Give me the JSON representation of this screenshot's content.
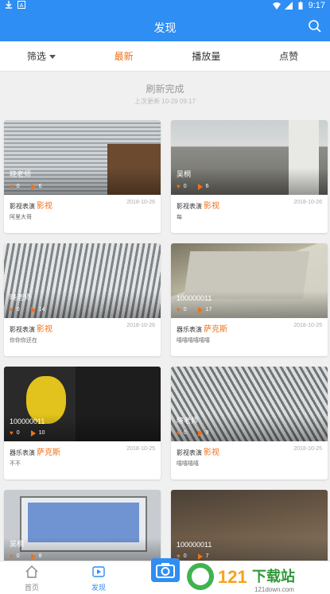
{
  "statusbar": {
    "time": "9:17"
  },
  "appbar": {
    "title": "发现"
  },
  "filters": [
    {
      "label": "筛选",
      "active": false
    },
    {
      "label": "最新",
      "active": true
    },
    {
      "label": "播放量",
      "active": false
    },
    {
      "label": "点赞",
      "active": false
    }
  ],
  "refresh": {
    "title": "刷新完成",
    "subtitle": "上次更新 10-29 09:17"
  },
  "cards": [
    {
      "author": "晓老师",
      "likes": "0",
      "plays": "6",
      "prefix": "影视表演",
      "category": "影视",
      "date": "2018-10-26",
      "desc": "阿里大哥"
    },
    {
      "author": "吴桐",
      "likes": "0",
      "plays": "6",
      "prefix": "影视表演",
      "category": "影视",
      "date": "2018-10-26",
      "desc": "每"
    },
    {
      "author": "晓老师",
      "likes": "0",
      "plays": "14",
      "prefix": "影视表演",
      "category": "影视",
      "date": "2018-10-26",
      "desc": "你你你还在"
    },
    {
      "author": "100000011",
      "likes": "0",
      "plays": "17",
      "prefix": "器乐表演",
      "category": "萨克斯",
      "date": "2018-10-25",
      "desc": "嘻嘻嘻嘻嘻嘻"
    },
    {
      "author": "100000011",
      "likes": "0",
      "plays": "10",
      "prefix": "器乐表演",
      "category": "萨克斯",
      "date": "2018-10-25",
      "desc": "不不"
    },
    {
      "author": "晓老师",
      "likes": "0",
      "plays": "9",
      "prefix": "影视表演",
      "category": "影视",
      "date": "2018-10-25",
      "desc": "嘻嘻嘻嘻"
    },
    {
      "author": "吴桐",
      "likes": "0",
      "plays": "8",
      "prefix": "",
      "category": "",
      "date": "",
      "desc": ""
    },
    {
      "author": "100000011",
      "likes": "0",
      "plays": "7",
      "prefix": "",
      "category": "",
      "date": "",
      "desc": ""
    }
  ],
  "nav": {
    "home": "首页",
    "discover": "发现"
  },
  "watermark": {
    "brand": "下载站",
    "url": "121down.com"
  },
  "colors": {
    "primary": "#2f8ef3",
    "accent": "#f0701a"
  }
}
